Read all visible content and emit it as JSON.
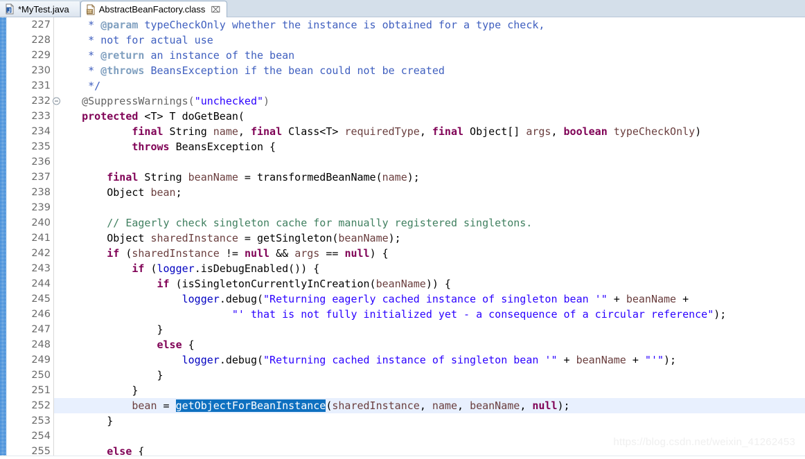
{
  "tabs": [
    {
      "label": "*MyTest.java",
      "icon": "java-file-icon",
      "active": false,
      "closable": false,
      "close_glyph": ""
    },
    {
      "label": "AbstractBeanFactory.class",
      "icon": "class-file-icon",
      "active": true,
      "closable": true,
      "close_glyph": "⌧"
    }
  ],
  "editor": {
    "first_line": 227,
    "fold_marker_line": 232,
    "current_line": 252,
    "selection_text": "getObjectForBeanInstance",
    "colors": {
      "keyword": "#7f0055",
      "string": "#2a00ff",
      "line_comment": "#3f7f5f",
      "javadoc": "#3f5fbf",
      "javadoc_tag": "#7f9fbf",
      "annotation": "#646464",
      "field": "#0000c0",
      "parameter": "#6a3e3e",
      "selection_bg": "#0e70c0",
      "current_line_bg": "#e8f0fe",
      "tabbar_bg": "#d4dfea"
    },
    "lines": [
      {
        "n": 227,
        "tokens": [
          {
            "t": "jdoc",
            "s": "     * "
          },
          {
            "t": "jtag",
            "s": "@param"
          },
          {
            "t": "jdoc",
            "s": " typeCheckOnly whether the instance is obtained for a type check,"
          }
        ]
      },
      {
        "n": 228,
        "tokens": [
          {
            "t": "jdoc",
            "s": "     * not for actual use"
          }
        ]
      },
      {
        "n": 229,
        "tokens": [
          {
            "t": "jdoc",
            "s": "     * "
          },
          {
            "t": "jtag",
            "s": "@return"
          },
          {
            "t": "jdoc",
            "s": " an instance of the bean"
          }
        ]
      },
      {
        "n": 230,
        "tokens": [
          {
            "t": "jdoc",
            "s": "     * "
          },
          {
            "t": "jtag",
            "s": "@throws"
          },
          {
            "t": "jdoc",
            "s": " BeansException if the bean could not be created"
          }
        ]
      },
      {
        "n": 231,
        "tokens": [
          {
            "t": "jdoc",
            "s": "     */"
          }
        ]
      },
      {
        "n": 232,
        "tokens": [
          {
            "t": "ann",
            "s": "    @SuppressWarnings("
          },
          {
            "t": "str",
            "s": "\"unchecked\""
          },
          {
            "t": "ann",
            "s": ")"
          }
        ]
      },
      {
        "n": 233,
        "tokens": [
          {
            "t": "plain",
            "s": "    "
          },
          {
            "t": "kw",
            "s": "protected"
          },
          {
            "t": "plain",
            "s": " <T> T doGetBean("
          }
        ]
      },
      {
        "n": 234,
        "tokens": [
          {
            "t": "plain",
            "s": "            "
          },
          {
            "t": "kw",
            "s": "final"
          },
          {
            "t": "plain",
            "s": " String "
          },
          {
            "t": "par",
            "s": "name"
          },
          {
            "t": "plain",
            "s": ", "
          },
          {
            "t": "kw",
            "s": "final"
          },
          {
            "t": "plain",
            "s": " Class<T> "
          },
          {
            "t": "par",
            "s": "requiredType"
          },
          {
            "t": "plain",
            "s": ", "
          },
          {
            "t": "kw",
            "s": "final"
          },
          {
            "t": "plain",
            "s": " Object[] "
          },
          {
            "t": "par",
            "s": "args"
          },
          {
            "t": "plain",
            "s": ", "
          },
          {
            "t": "kw",
            "s": "boolean"
          },
          {
            "t": "plain",
            "s": " "
          },
          {
            "t": "par",
            "s": "typeCheckOnly"
          },
          {
            "t": "plain",
            "s": ")"
          }
        ]
      },
      {
        "n": 235,
        "tokens": [
          {
            "t": "plain",
            "s": "            "
          },
          {
            "t": "kw",
            "s": "throws"
          },
          {
            "t": "plain",
            "s": " BeansException {"
          }
        ]
      },
      {
        "n": 236,
        "tokens": [
          {
            "t": "plain",
            "s": ""
          }
        ]
      },
      {
        "n": 237,
        "tokens": [
          {
            "t": "plain",
            "s": "        "
          },
          {
            "t": "kw",
            "s": "final"
          },
          {
            "t": "plain",
            "s": " String "
          },
          {
            "t": "par",
            "s": "beanName"
          },
          {
            "t": "plain",
            "s": " = transformedBeanName("
          },
          {
            "t": "par",
            "s": "name"
          },
          {
            "t": "plain",
            "s": ");"
          }
        ]
      },
      {
        "n": 238,
        "tokens": [
          {
            "t": "plain",
            "s": "        Object "
          },
          {
            "t": "par",
            "s": "bean"
          },
          {
            "t": "plain",
            "s": ";"
          }
        ]
      },
      {
        "n": 239,
        "tokens": [
          {
            "t": "plain",
            "s": ""
          }
        ]
      },
      {
        "n": 240,
        "tokens": [
          {
            "t": "cmt",
            "s": "        // Eagerly check singleton cache for manually registered singletons."
          }
        ]
      },
      {
        "n": 241,
        "tokens": [
          {
            "t": "plain",
            "s": "        Object "
          },
          {
            "t": "par",
            "s": "sharedInstance"
          },
          {
            "t": "plain",
            "s": " = getSingleton("
          },
          {
            "t": "par",
            "s": "beanName"
          },
          {
            "t": "plain",
            "s": ");"
          }
        ]
      },
      {
        "n": 242,
        "tokens": [
          {
            "t": "plain",
            "s": "        "
          },
          {
            "t": "kw",
            "s": "if"
          },
          {
            "t": "plain",
            "s": " ("
          },
          {
            "t": "par",
            "s": "sharedInstance"
          },
          {
            "t": "plain",
            "s": " != "
          },
          {
            "t": "kw",
            "s": "null"
          },
          {
            "t": "plain",
            "s": " && "
          },
          {
            "t": "par",
            "s": "args"
          },
          {
            "t": "plain",
            "s": " == "
          },
          {
            "t": "kw",
            "s": "null"
          },
          {
            "t": "plain",
            "s": ") {"
          }
        ]
      },
      {
        "n": 243,
        "tokens": [
          {
            "t": "plain",
            "s": "            "
          },
          {
            "t": "kw",
            "s": "if"
          },
          {
            "t": "plain",
            "s": " ("
          },
          {
            "t": "fld",
            "s": "logger"
          },
          {
            "t": "plain",
            "s": ".isDebugEnabled()) {"
          }
        ]
      },
      {
        "n": 244,
        "tokens": [
          {
            "t": "plain",
            "s": "                "
          },
          {
            "t": "kw",
            "s": "if"
          },
          {
            "t": "plain",
            "s": " (isSingletonCurrentlyInCreation("
          },
          {
            "t": "par",
            "s": "beanName"
          },
          {
            "t": "plain",
            "s": ")) {"
          }
        ]
      },
      {
        "n": 245,
        "tokens": [
          {
            "t": "plain",
            "s": "                    "
          },
          {
            "t": "fld",
            "s": "logger"
          },
          {
            "t": "plain",
            "s": ".debug("
          },
          {
            "t": "str",
            "s": "\"Returning eagerly cached instance of singleton bean '\""
          },
          {
            "t": "plain",
            "s": " + "
          },
          {
            "t": "par",
            "s": "beanName"
          },
          {
            "t": "plain",
            "s": " +"
          }
        ]
      },
      {
        "n": 246,
        "tokens": [
          {
            "t": "plain",
            "s": "                            "
          },
          {
            "t": "str",
            "s": "\"' that is not fully initialized yet - a consequence of a circular reference\""
          },
          {
            "t": "plain",
            "s": ");"
          }
        ]
      },
      {
        "n": 247,
        "tokens": [
          {
            "t": "plain",
            "s": "                }"
          }
        ]
      },
      {
        "n": 248,
        "tokens": [
          {
            "t": "plain",
            "s": "                "
          },
          {
            "t": "kw",
            "s": "else"
          },
          {
            "t": "plain",
            "s": " {"
          }
        ]
      },
      {
        "n": 249,
        "tokens": [
          {
            "t": "plain",
            "s": "                    "
          },
          {
            "t": "fld",
            "s": "logger"
          },
          {
            "t": "plain",
            "s": ".debug("
          },
          {
            "t": "str",
            "s": "\"Returning cached instance of singleton bean '\""
          },
          {
            "t": "plain",
            "s": " + "
          },
          {
            "t": "par",
            "s": "beanName"
          },
          {
            "t": "plain",
            "s": " + "
          },
          {
            "t": "str",
            "s": "\"'\""
          },
          {
            "t": "plain",
            "s": ");"
          }
        ]
      },
      {
        "n": 250,
        "tokens": [
          {
            "t": "plain",
            "s": "                }"
          }
        ]
      },
      {
        "n": 251,
        "tokens": [
          {
            "t": "plain",
            "s": "            }"
          }
        ]
      },
      {
        "n": 252,
        "tokens": [
          {
            "t": "plain",
            "s": "            "
          },
          {
            "t": "par",
            "s": "bean"
          },
          {
            "t": "plain",
            "s": " = "
          },
          {
            "t": "sel",
            "s": "getObjectForBeanInstance"
          },
          {
            "t": "plain",
            "s": "("
          },
          {
            "t": "par",
            "s": "sharedInstance"
          },
          {
            "t": "plain",
            "s": ", "
          },
          {
            "t": "par",
            "s": "name"
          },
          {
            "t": "plain",
            "s": ", "
          },
          {
            "t": "par",
            "s": "beanName"
          },
          {
            "t": "plain",
            "s": ", "
          },
          {
            "t": "kw",
            "s": "null"
          },
          {
            "t": "plain",
            "s": ");"
          }
        ]
      },
      {
        "n": 253,
        "tokens": [
          {
            "t": "plain",
            "s": "        }"
          }
        ]
      },
      {
        "n": 254,
        "tokens": [
          {
            "t": "plain",
            "s": ""
          }
        ]
      },
      {
        "n": 255,
        "tokens": [
          {
            "t": "plain",
            "s": "        "
          },
          {
            "t": "kw",
            "s": "else"
          },
          {
            "t": "plain",
            "s": " {"
          }
        ]
      }
    ]
  },
  "watermark": "https://blog.csdn.net/weixin_41262453"
}
